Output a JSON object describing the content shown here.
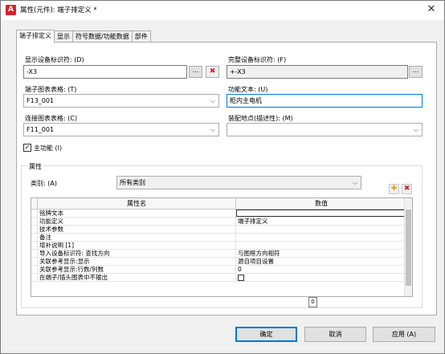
{
  "window": {
    "title": "属性(元件): 端子排定义 *",
    "app_icon_glyph": "A",
    "close_glyph": "✕"
  },
  "tabs": [
    {
      "label": "端子排定义",
      "active": true
    },
    {
      "label": "显示",
      "active": false
    },
    {
      "label": "符号数据/功能数据",
      "active": false
    },
    {
      "label": "部件",
      "active": false
    }
  ],
  "form": {
    "display_id_label": "显示设备标识符: (D)",
    "display_id_value": "-X3",
    "full_id_label": "完整设备标识符: (F)",
    "full_id_value": "+-X3",
    "terminal_chart_label": "端子图表表格: (T)",
    "terminal_chart_value": "F13_001",
    "function_text_label": "功能文本: (U)",
    "function_text_value": "柜内主电机",
    "connection_chart_label": "连接图表表格: (C)",
    "connection_chart_value": "F11_001",
    "mounting_label": "装配地点(描述性): (M)",
    "mounting_value": "",
    "main_function_label": "主功能 (I)",
    "main_function_checked": true,
    "browse_glyph": "...",
    "delete_glyph": "✖",
    "caret_glyph": "⌵",
    "check_glyph": "✓"
  },
  "properties": {
    "group_title": "属性",
    "category_label": "类别: (A)",
    "category_value": "所有类别",
    "add_glyph": "✚",
    "remove_glyph": "✖",
    "columns": [
      "属性名",
      "数值"
    ],
    "rows": [
      {
        "name": "铭牌文本",
        "value": ""
      },
      {
        "name": "功能定义",
        "value": "端子排定义"
      },
      {
        "name": "技术参数",
        "value": ""
      },
      {
        "name": "备注",
        "value": ""
      },
      {
        "name": "增补说明 [1]",
        "value": ""
      },
      {
        "name": "导入设备标识符: 查找方向",
        "value": "与图框方向相符"
      },
      {
        "name": "关联参考显示:显示",
        "value": "源自项目设置"
      },
      {
        "name": "关联参考显示:行数/列数",
        "value": "0"
      },
      {
        "name": "在端子/插头图表中不输出",
        "value": ""
      }
    ],
    "badge_value": "0"
  },
  "buttons": {
    "ok": "确定",
    "cancel": "取消",
    "apply": "应用 (A)"
  },
  "colors": {
    "accent": "#0078d7",
    "danger": "#d8232a",
    "dialog_bg": "#f0f0f0"
  }
}
